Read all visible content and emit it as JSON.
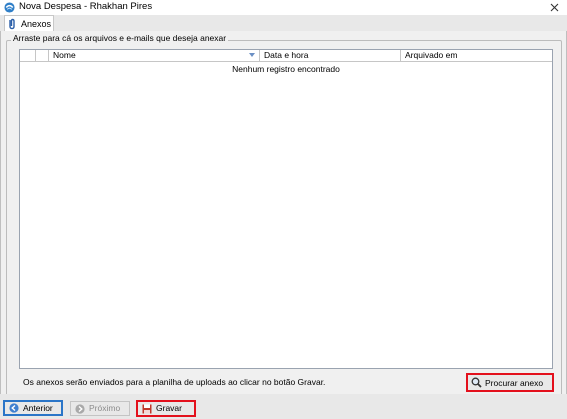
{
  "window": {
    "title": "Nova Despesa - Rhakhan Pires",
    "close_label": "✕"
  },
  "tabs": [
    {
      "label": "Anexos",
      "icon": "paperclip-icon",
      "active": true
    }
  ],
  "group": {
    "legend": "Arraste para cá os arquivos e e-mails que deseja anexar"
  },
  "grid": {
    "columns": [
      "",
      "",
      "Nome",
      "Data e hora",
      "Arquivado em"
    ],
    "empty_message": "Nenhum registro encontrado",
    "rows": []
  },
  "info_text": "Os anexos serão enviados para a planilha de uploads ao clicar no botão Gravar.",
  "buttons": {
    "procurar_anexo": "Procurar anexo",
    "anterior": "Anterior",
    "proximo": "Próximo",
    "gravar": "Gravar"
  },
  "colors": {
    "highlight_red": "#e3101c",
    "focus_blue": "#2a75c8"
  }
}
